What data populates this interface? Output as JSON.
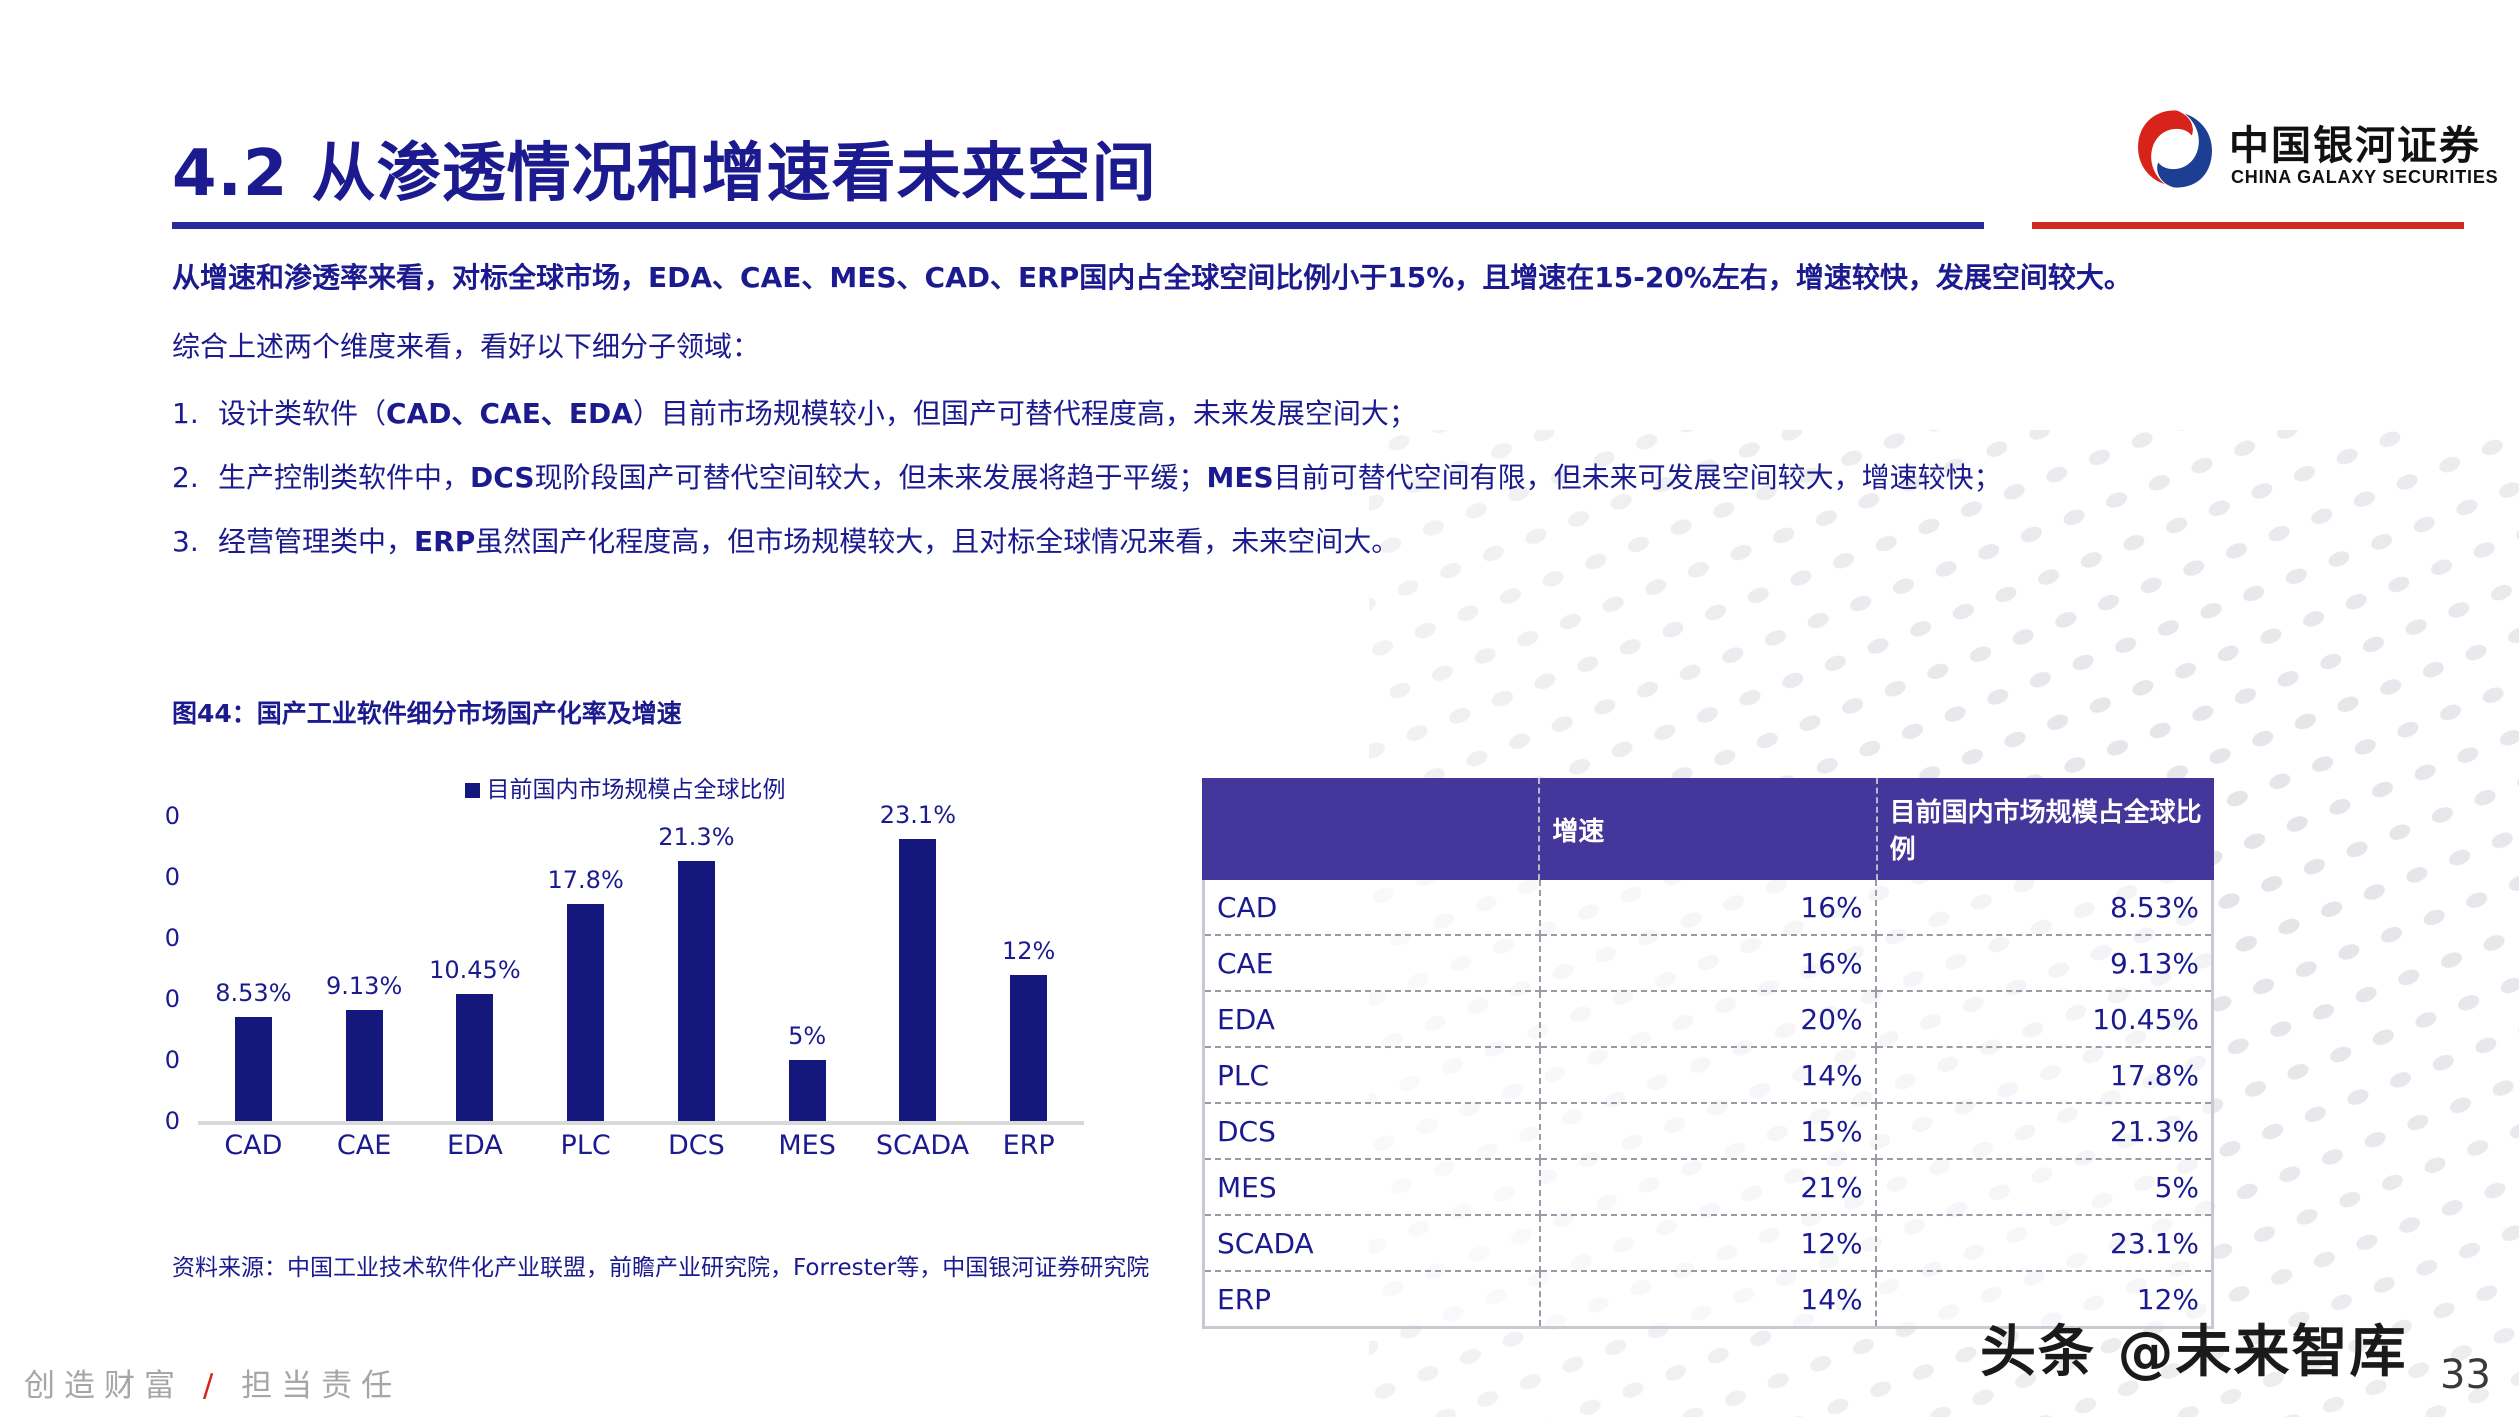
{
  "header": {
    "title": "4.2 从渗透情况和增速看未来空间",
    "logo_cn": "中国银河证券",
    "logo_en": "CHINA GALAXY SECURITIES",
    "rule_blue_color": "#2a2a9c",
    "rule_red_color": "#d22a1e"
  },
  "body": {
    "lead_parts": [
      {
        "text": "从增速和渗透率来看，对标全球市场，",
        "bold": false
      },
      {
        "text": "EDA、CAE、MES、CAD、ERP国内占全球空间比例小于15%，且增速在15-20%左右，增速较快，发展空间较大。",
        "bold": true
      }
    ],
    "lead_plain": "从增速和渗透率来看，对标全球市场，EDA、CAE、MES、CAD、ERP国内占全球空间比例小于15%，且增速在15-20%左右，增速较快，发展空间较大。",
    "intro": "综合上述两个维度来看，看好以下细分子领域：",
    "list": [
      {
        "num": "1.",
        "segments": [
          {
            "text": "设计类软件（",
            "bold": false
          },
          {
            "text": "CAD、CAE、EDA",
            "bold": true
          },
          {
            "text": "）目前市场规模较小，但国产可替代程度高，未来发展空间大；",
            "bold": false
          }
        ]
      },
      {
        "num": "2.",
        "segments": [
          {
            "text": "生产控制类软件中，",
            "bold": false
          },
          {
            "text": "DCS",
            "bold": true
          },
          {
            "text": "现阶段国产可替代空间较大，但未来发展将趋于平缓；",
            "bold": false
          },
          {
            "text": "MES",
            "bold": true
          },
          {
            "text": "目前可替代空间有限，但未来可发展空间较大，增速较快；",
            "bold": false
          }
        ]
      },
      {
        "num": "3.",
        "segments": [
          {
            "text": "经营管理类中，",
            "bold": false
          },
          {
            "text": "ERP",
            "bold": true
          },
          {
            "text": "虽然国产化程度高，但市场规模较大，且对标全球情况来看，未来空间大。",
            "bold": false
          }
        ]
      }
    ]
  },
  "figure": {
    "caption": "图44：国产工业软件细分市场国产化率及增速",
    "source": "资料来源：中国工业技术软件化产业联盟，前瞻产业研究院，Forrester等，中国银河证券研究院"
  },
  "chart_data": {
    "type": "bar",
    "title": "",
    "legend": [
      "目前国内市场规模占全球比例"
    ],
    "legend_position": "top-center",
    "categories": [
      "CAD",
      "CAE",
      "EDA",
      "PLC",
      "DCS",
      "MES",
      "SCADA",
      "ERP"
    ],
    "values": [
      8.53,
      9.13,
      10.45,
      17.8,
      21.3,
      5,
      23.1,
      12
    ],
    "data_labels": [
      "8.53%",
      "9.13%",
      "10.45%",
      "17.8%",
      "21.3%",
      "5%",
      "23.1%",
      "12%"
    ],
    "xlabel": "",
    "ylabel": "",
    "ylim": [
      0,
      25
    ],
    "ytick_labels": [
      "0",
      "0",
      "0",
      "0",
      "0",
      "0"
    ],
    "grid": false,
    "bar_color": "#14187d",
    "axis_color": "#d9d9d9"
  },
  "table": {
    "columns": [
      "",
      "增速",
      "目前国内市场规模占全球比例"
    ],
    "header_bg": "#44369b",
    "header_color": "#ffffff",
    "rows": [
      {
        "name": "CAD",
        "growth": "16%",
        "share": "8.53%"
      },
      {
        "name": "CAE",
        "growth": "16%",
        "share": "9.13%"
      },
      {
        "name": "EDA",
        "growth": "20%",
        "share": "10.45%"
      },
      {
        "name": "PLC",
        "growth": "14%",
        "share": "17.8%"
      },
      {
        "name": "DCS",
        "growth": "15%",
        "share": "21.3%"
      },
      {
        "name": "MES",
        "growth": "21%",
        "share": "5%"
      },
      {
        "name": "SCADA",
        "growth": "12%",
        "share": "23.1%"
      },
      {
        "name": "ERP",
        "growth": "14%",
        "share": "12%"
      }
    ]
  },
  "footer": {
    "tagline_left": "创造财富",
    "tagline_slash": "/",
    "tagline_right": "担当责任",
    "watermark": "头条 @未来智库",
    "page_number": "33"
  }
}
